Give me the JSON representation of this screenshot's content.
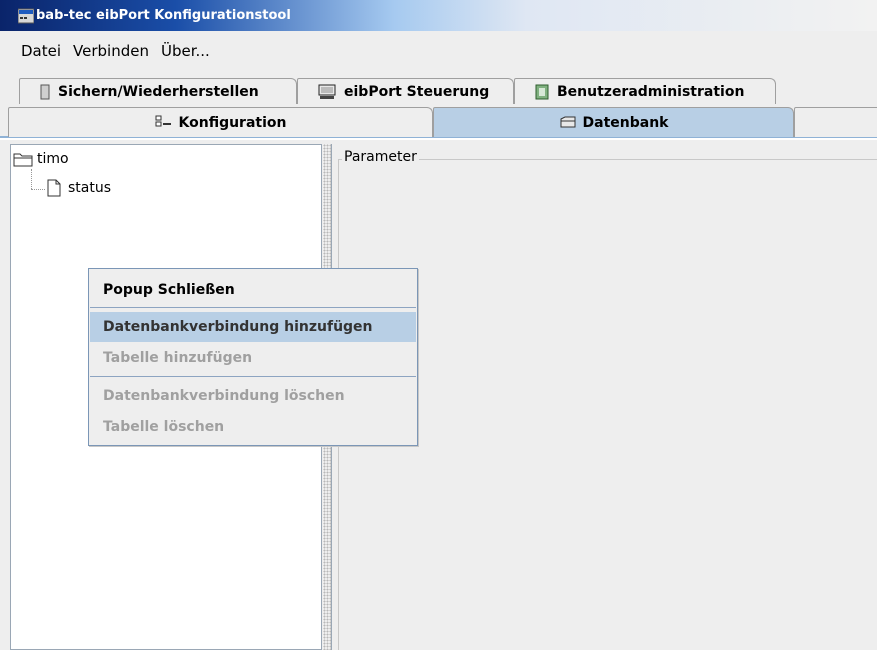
{
  "window": {
    "title": "bab-tec eibPort Konfigurationstool"
  },
  "menu": {
    "items": [
      "Datei",
      "Verbinden",
      "Über..."
    ]
  },
  "tabs_row1": [
    {
      "label": "Sichern/Wiederherstellen",
      "icon": "device-icon"
    },
    {
      "label": "eibPort Steuerung",
      "icon": "monitor-icon"
    },
    {
      "label": "Benutzeradministration",
      "icon": "user-admin-icon"
    }
  ],
  "tabs_row2": [
    {
      "label": "Konfiguration",
      "icon": "config-list-icon",
      "active": false
    },
    {
      "label": "Datenbank",
      "icon": "database-icon",
      "active": true
    }
  ],
  "tree": {
    "root": {
      "label": "timo",
      "icon": "folder-icon"
    },
    "children": [
      {
        "label": "status",
        "icon": "file-icon"
      }
    ]
  },
  "parameter_panel": {
    "legend": "Parameter"
  },
  "popup": {
    "items": [
      {
        "label": "Popup Schließen",
        "enabled": true,
        "highlighted": false
      },
      {
        "label": "Datenbankverbindung hinzufügen",
        "enabled": true,
        "highlighted": true
      },
      {
        "label": "Tabelle hinzufügen",
        "enabled": false,
        "highlighted": false
      },
      {
        "label": "Datenbankverbindung löschen",
        "enabled": false,
        "highlighted": false
      },
      {
        "label": "Tabelle löschen",
        "enabled": false,
        "highlighted": false
      }
    ]
  },
  "colors": {
    "title_gradient_start": "#0a246a",
    "tab_active": "#b8cfe5",
    "highlight": "#b8cfe5",
    "disabled_text": "#a0a0a0",
    "background": "#eeeeee"
  }
}
